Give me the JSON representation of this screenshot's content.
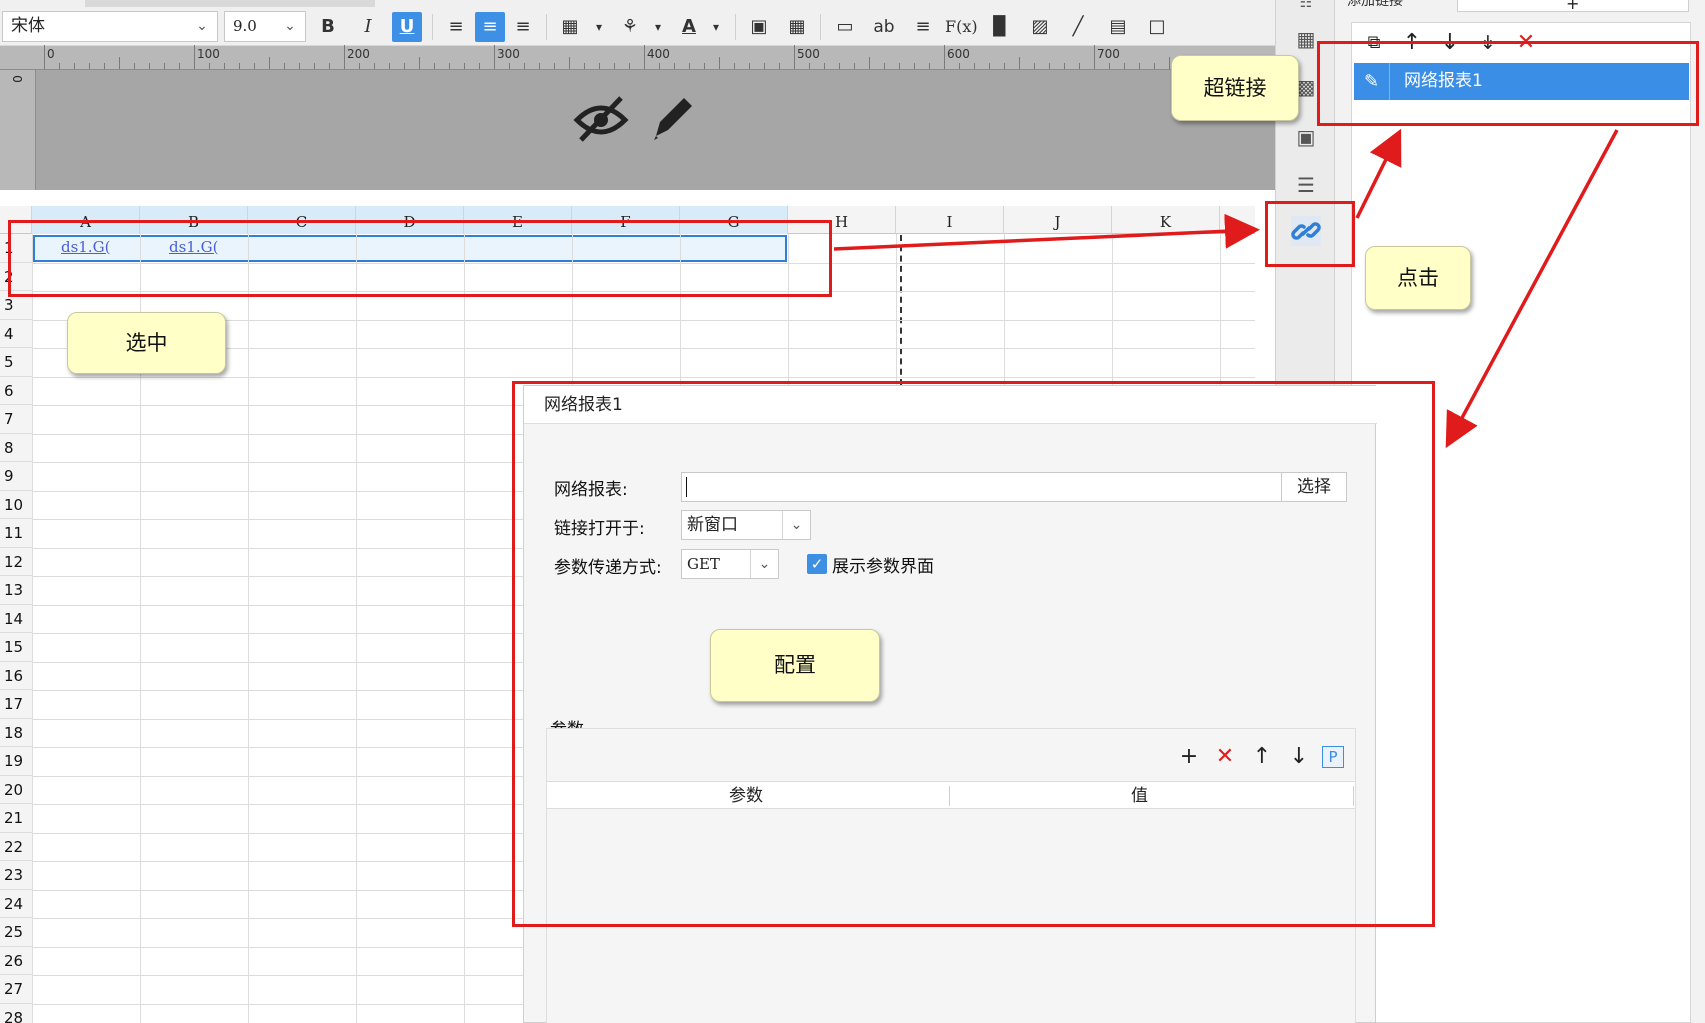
{
  "toolbar": {
    "font_name": "宋体",
    "font_size": "9.0",
    "bold_label": "B",
    "italic_label": "I",
    "underline_label": "U",
    "text_btn_ab": "ab",
    "formula_btn": "F(x)"
  },
  "ruler": {
    "labels": [
      "0",
      "100",
      "200",
      "300",
      "400",
      "500",
      "600",
      "700"
    ],
    "vertical_label": "0"
  },
  "grid": {
    "columns": [
      "A",
      "B",
      "C",
      "D",
      "E",
      "F",
      "G",
      "H",
      "I",
      "J",
      "K"
    ],
    "rows": [
      "1",
      "2",
      "3",
      "4",
      "5",
      "6",
      "7",
      "8",
      "9",
      "10",
      "11",
      "12",
      "13",
      "14",
      "15",
      "16",
      "17",
      "18",
      "19",
      "20",
      "21",
      "22",
      "23",
      "24",
      "25",
      "26",
      "27",
      "28"
    ],
    "cell_a1": "ds1.G(",
    "cell_b1": "ds1.G("
  },
  "right_panel": {
    "header_text": "添加链接",
    "link_item_label": "网络报表1"
  },
  "config": {
    "title": "网络报表1",
    "report_label": "网络报表:",
    "report_value": "",
    "select_button": "选择",
    "open_in_label": "链接打开于:",
    "open_in_value": "新窗口",
    "param_method_label": "参数传递方式:",
    "param_method_value": "GET",
    "show_params_checked": true,
    "show_params_label": "展示参数界面",
    "params_section_label": "参数",
    "params_btn_p": "P",
    "table_columns": [
      "参数",
      "值"
    ]
  },
  "annotations": {
    "hyperlink_note": "超链接",
    "click_note": "点击",
    "select_note": "选中",
    "config_note": "配置"
  },
  "colors": {
    "annotation_red": "#e01b1b",
    "note_yellow": "#ffffc7",
    "selection_blue": "#3b8ee6",
    "link_text": "#4a5fd6"
  }
}
